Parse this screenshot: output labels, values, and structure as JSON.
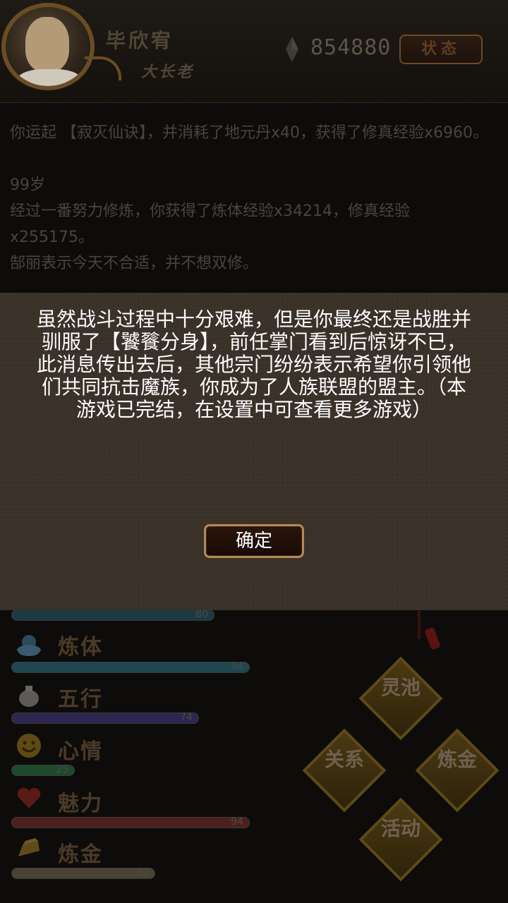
{
  "header": {
    "name": "毕欣宥",
    "rank": "大长老",
    "currency_value": "854880",
    "status_button": "状态"
  },
  "log": {
    "lines": [
      "你运起 【寂灭仙诀】，并消耗了地元丹x40，获得了修真经验x6960。",
      "",
      "99岁",
      "经过一番努力修炼，你获得了炼体经验x34214，修真经验x255175。",
      "郜丽表示今天不合适，并不想双修。"
    ]
  },
  "modal": {
    "message": "虽然战斗过程中十分艰难，但是你最终还是战胜并驯服了【饕餮分身】，前任掌门看到后惊讶不已，此消息传出去后，其他宗门纷纷表示希望你引领他们共同抗击魔族，你成为了人族联盟的盟主。（本游戏已完结，在设置中可查看更多游戏）",
    "confirm_button": "确定"
  },
  "stats": {
    "top_bar_value": "80",
    "items": [
      {
        "label": "炼体",
        "value": "94",
        "icon": "cloud-orb-icon",
        "color": "#1f4750"
      },
      {
        "label": "五行",
        "value": "74",
        "icon": "pouch-icon",
        "color": "#2d2650"
      },
      {
        "label": "心情",
        "value": "25",
        "icon": "smiley-icon",
        "color": "#1e4a2c"
      },
      {
        "label": "魅力",
        "value": "94",
        "icon": "heart-icon",
        "color": "#4e1f1f"
      },
      {
        "label": "炼金",
        "value": "57",
        "icon": "gold-ingot-icon",
        "color": "#4a4232"
      }
    ]
  },
  "actions": {
    "pool": "灵池",
    "relations": "关系",
    "alchemy": "炼金",
    "activity": "活动"
  }
}
